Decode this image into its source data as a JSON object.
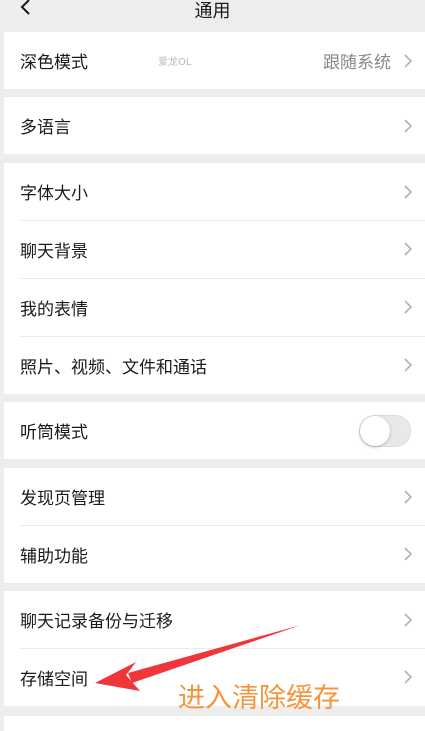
{
  "nav": {
    "title": "通用",
    "back_icon": "chevron-left-icon"
  },
  "settings": {
    "dark_mode": {
      "label": "深色模式",
      "value": "跟随系统",
      "watermark": "爱龙OL"
    },
    "language": {
      "label": "多语言"
    },
    "font_size": {
      "label": "字体大小"
    },
    "chat_background": {
      "label": "聊天背景"
    },
    "my_stickers": {
      "label": "我的表情"
    },
    "media_files_calls": {
      "label": "照片、视频、文件和通话"
    },
    "earpiece_mode": {
      "label": "听筒模式",
      "enabled": false
    },
    "discover_management": {
      "label": "发现页管理"
    },
    "accessibility": {
      "label": "辅助功能"
    },
    "chat_backup_migration": {
      "label": "聊天记录备份与迁移"
    },
    "storage": {
      "label": "存储空间"
    }
  },
  "annotation": {
    "text": "进入清除缓存",
    "color": "#f5943a",
    "arrow_color": "#f0353b"
  },
  "colors": {
    "background": "#ededed",
    "cell": "#ffffff",
    "chevron": "#b2b2b2"
  }
}
